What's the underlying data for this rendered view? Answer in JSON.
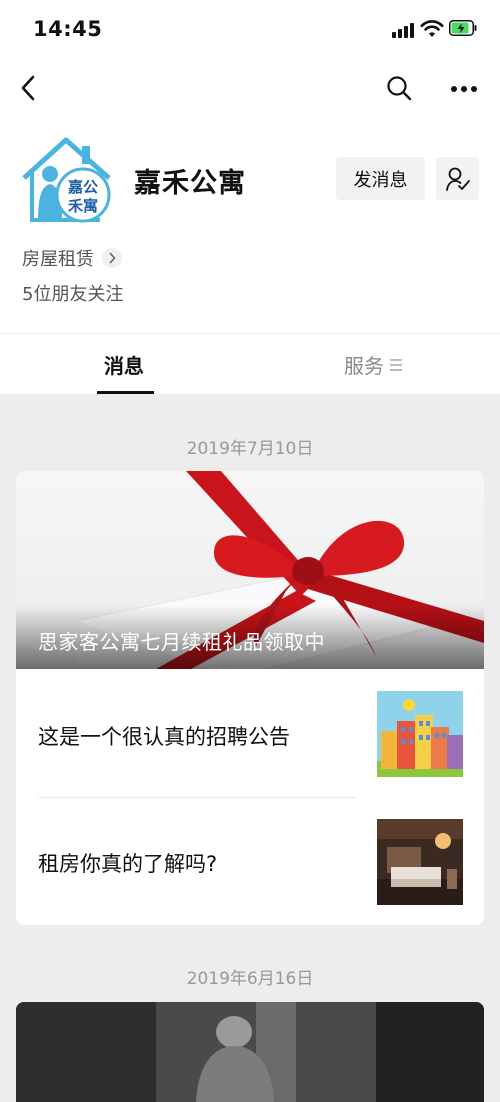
{
  "status": {
    "time": "14:45"
  },
  "profile": {
    "logo_text": "嘉公禾寓",
    "name": "嘉禾公寓",
    "message_button": "发消息",
    "category": "房屋租赁",
    "followers": "5位朋友关注"
  },
  "tabs": {
    "messages": "消息",
    "services": "服务"
  },
  "feed": [
    {
      "date": "2019年7月10日",
      "hero_title": "思家客公寓七月续租礼品领取中",
      "items": [
        {
          "title": "这是一个很认真的招聘公告"
        },
        {
          "title": "租房你真的了解吗?"
        }
      ]
    },
    {
      "date": "2019年6月16日"
    }
  ],
  "colors": {
    "ribbon": "#d0161c",
    "logo_blue": "#4ab3e0",
    "background": "#ededed"
  }
}
